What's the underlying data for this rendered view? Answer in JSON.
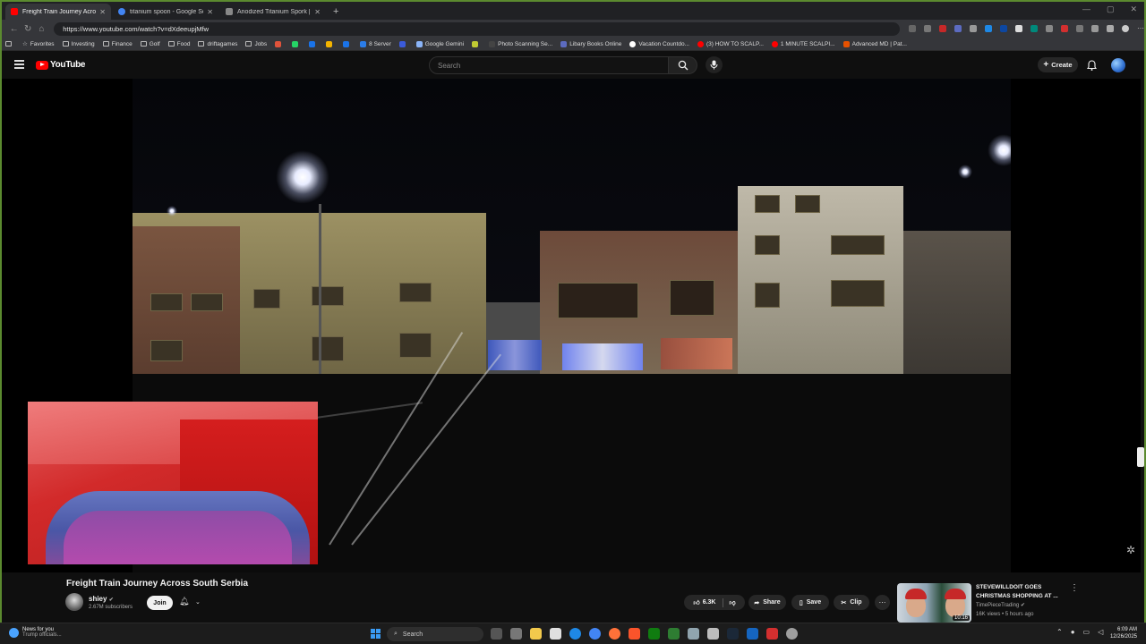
{
  "browser": {
    "tabs": [
      {
        "label": "Freight Train Journey Across South",
        "active": true,
        "fav_color": "#ff0000"
      },
      {
        "label": "titanium spoon - Google Search",
        "active": false,
        "fav_color": "#4285f4"
      },
      {
        "label": "Anodized Titanium Spork | Eating",
        "active": false,
        "fav_color": "#888888"
      }
    ],
    "new_tab": "+",
    "url": "https://www.youtube.com/watch?v=dXdeeupjMfw",
    "bookmarks": [
      {
        "label": "Favorites",
        "kind": "star"
      },
      {
        "label": "Investing",
        "kind": "folder"
      },
      {
        "label": "Finance",
        "kind": "folder"
      },
      {
        "label": "Golf",
        "kind": "folder"
      },
      {
        "label": "Food",
        "kind": "folder"
      },
      {
        "label": "driftagames",
        "kind": "folder"
      },
      {
        "label": "Jobs",
        "kind": "folder"
      },
      {
        "label": "",
        "kind": "icon",
        "color": "#e0533b"
      },
      {
        "label": "",
        "kind": "icon",
        "color": "#25d366"
      },
      {
        "label": "",
        "kind": "icon",
        "color": "#1a73e8"
      },
      {
        "label": "",
        "kind": "icon",
        "color": "#f4b400"
      },
      {
        "label": "",
        "kind": "icon",
        "color": "#1a73e8"
      },
      {
        "label": "8 Server",
        "kind": "icon",
        "color": "#2b7de9"
      },
      {
        "label": "",
        "kind": "icon",
        "color": "#3b5bdb"
      },
      {
        "label": "Google Gemini",
        "kind": "icon",
        "color": "#8ab4f8"
      },
      {
        "label": "",
        "kind": "icon",
        "color": "#c0ca33"
      },
      {
        "label": "Photo Scanning Se...",
        "kind": "icon",
        "color": "#444444"
      },
      {
        "label": "Libary Books Online",
        "kind": "icon",
        "color": "#5c6bc0"
      },
      {
        "label": "Vacation Countdo...",
        "kind": "icon",
        "color": "#ffffff"
      },
      {
        "label": "(3) HOW TO SCALP...",
        "kind": "icon",
        "color": "#ff0000"
      },
      {
        "label": "1 MINUTE SCALPI...",
        "kind": "icon",
        "color": "#ff0000"
      },
      {
        "label": "Advanced MD | Pat...",
        "kind": "icon",
        "color": "#e65100"
      }
    ]
  },
  "youtube": {
    "logo_text": "YouTube",
    "search_placeholder": "Search",
    "create_label": "Create",
    "video": {
      "title": "Freight Train Journey Across South Serbia",
      "channel": "shiey",
      "subscribers": "2.67M subscribers",
      "join_label": "Join",
      "likes": "6.3K",
      "share_label": "Share",
      "save_label": "Save",
      "clip_label": "Clip"
    },
    "recommended": {
      "title": "STEVEWILLDOIT GOES CHRISTMAS SHOPPING AT ...",
      "channel": "TimePieceTrading",
      "meta": "16K views • 5 hours ago",
      "duration": "10:16"
    }
  },
  "taskbar": {
    "news_title": "News for you",
    "news_sub": "Trump officials...",
    "search_label": "Search",
    "time": "6:09 AM",
    "date": "12/26/2025"
  },
  "colors": {
    "accent": "#ff0000",
    "window_border": "#5b8a2f",
    "background": "#0f0f0f"
  }
}
